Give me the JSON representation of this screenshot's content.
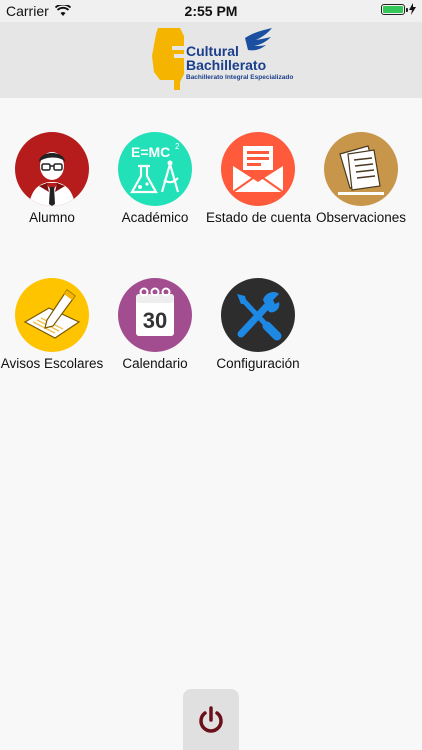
{
  "status_bar": {
    "carrier": "Carrier",
    "time": "2:55 PM",
    "battery_level": 1.0
  },
  "header": {
    "logo_line1": "Cultural",
    "logo_line2": "Bachillerato",
    "logo_sub": "Bachillerato Integral Especializado"
  },
  "menu": {
    "items": [
      {
        "label": "Alumno",
        "icon": "student-icon",
        "color": "#b71c1c"
      },
      {
        "label": "Académico",
        "icon": "science-icon",
        "color": "#22e0b8"
      },
      {
        "label": "Estado de cuenta",
        "icon": "envelope-icon",
        "color": "#ff5a3c"
      },
      {
        "label": "Observaciones",
        "icon": "notes-icon",
        "color": "#c8964a"
      },
      {
        "label": "Avisos Escolares",
        "icon": "pencil-paper-icon",
        "color": "#ffc400"
      },
      {
        "label": "Calendario",
        "icon": "calendar-icon",
        "color": "#a24d8f",
        "day": "30"
      },
      {
        "label": "Configuración",
        "icon": "tools-icon",
        "color": "#2d2d2d"
      }
    ]
  },
  "power": {
    "icon": "power-icon",
    "color": "#6b0f1a"
  }
}
